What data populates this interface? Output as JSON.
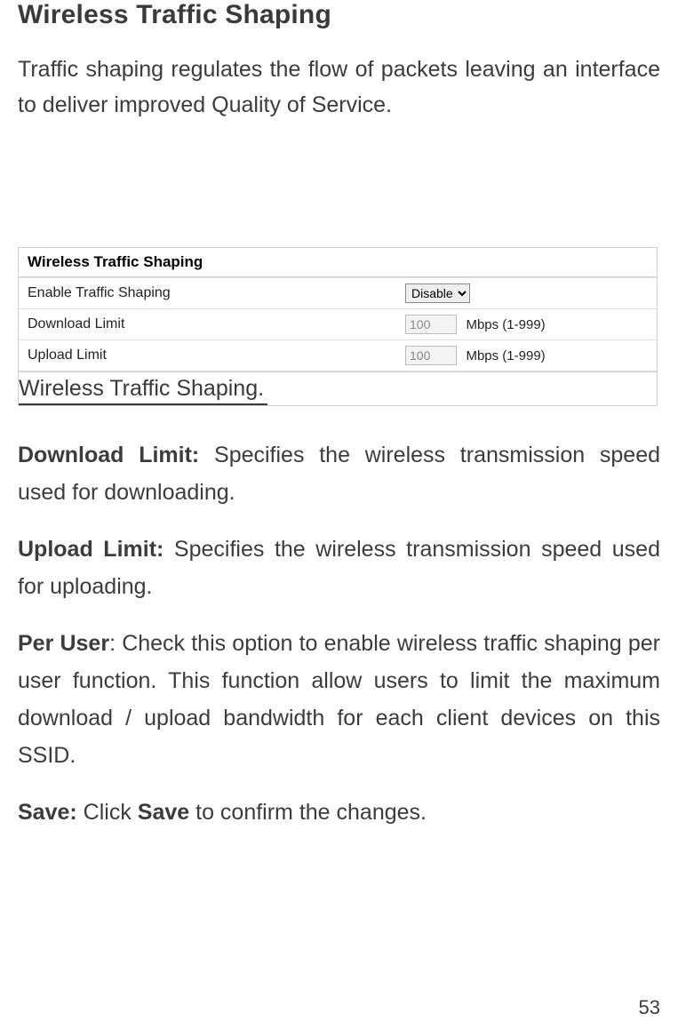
{
  "title": "Wireless Traffic Shaping",
  "intro": "Traffic shaping regulates the flow of packets leaving an interface to deliver improved Quality of Service.",
  "panel": {
    "header": "Wireless Traffic Shaping",
    "rows": {
      "enable": {
        "label": "Enable Traffic Shaping",
        "value": "Disable"
      },
      "download": {
        "label": "Download Limit",
        "value": "100",
        "unit": "Mbps (1-999)"
      },
      "upload": {
        "label": "Upload Limit",
        "value": "100",
        "unit": "Mbps (1-999)"
      }
    }
  },
  "caption": "Wireless Traffic Shaping.",
  "definitions": {
    "download_limit": {
      "term": "Download Limit:",
      "desc": " Specifies the wireless transmission speed used for downloading."
    },
    "upload_limit": {
      "term": "Upload Limit:",
      "desc": " Specifies the wireless transmission speed used for uploading."
    },
    "per_user": {
      "term": "Per User",
      "desc": ": Check this option to enable wireless traffic shaping per user function. This function allow users to limit the maximum download / upload bandwidth for each client devices on this SSID."
    },
    "save": {
      "term": "Save:",
      "mid": " Click ",
      "term2": "Save",
      "desc": " to confirm the changes."
    }
  },
  "page_number": "53"
}
